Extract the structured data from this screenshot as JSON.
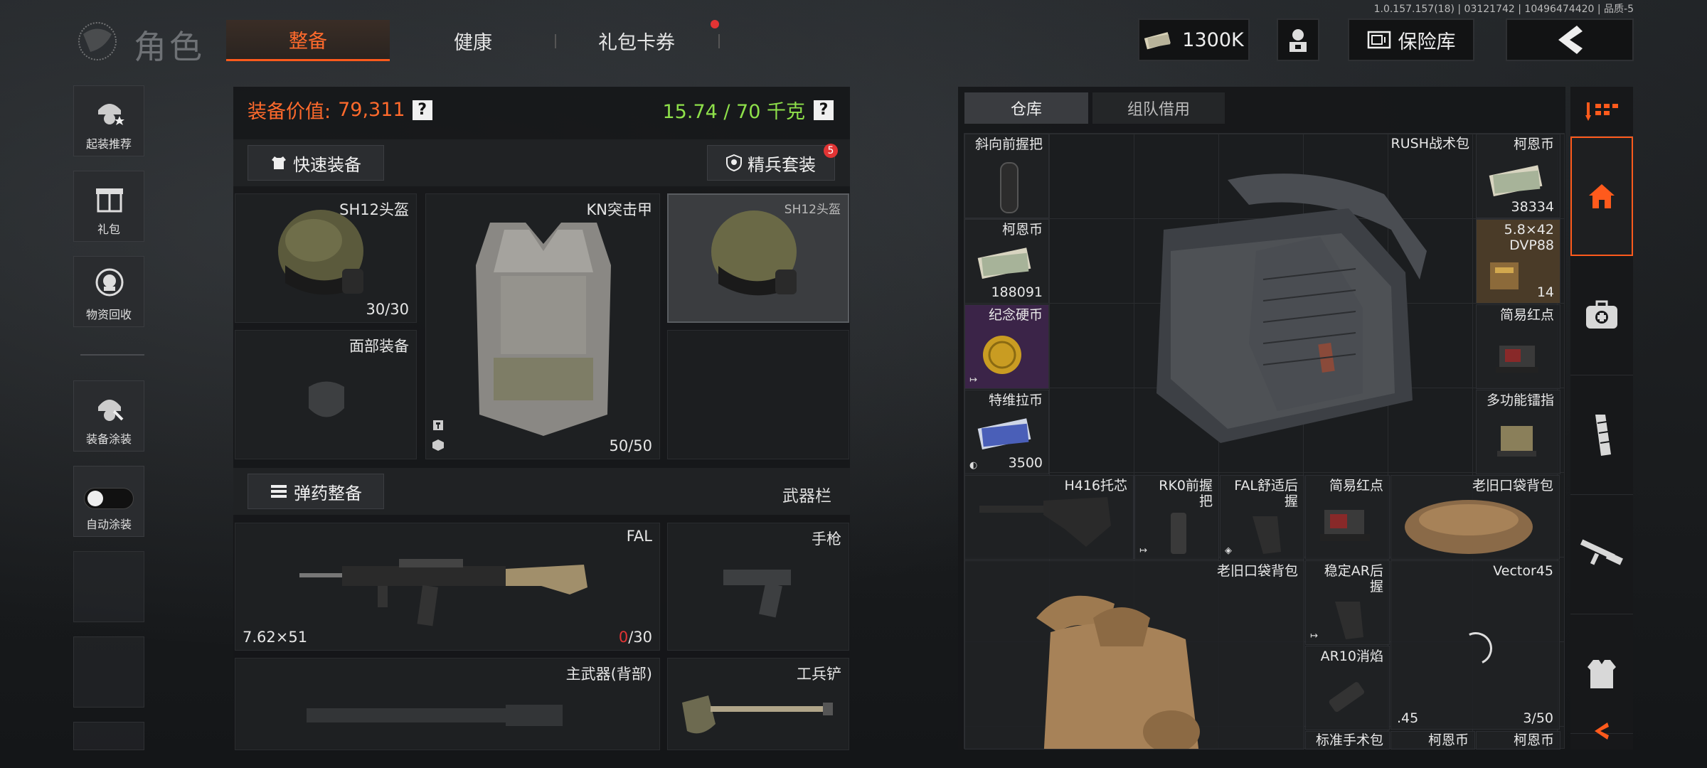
{
  "version": "1.0.157.157(18) | 03121742 | 10496474420 | 品质-5",
  "header": {
    "title": "角色",
    "tabs": [
      {
        "label": "整备",
        "active": true
      },
      {
        "label": "健康",
        "active": false
      },
      {
        "label": "礼包卡券",
        "active": false,
        "badge_dot": true
      }
    ],
    "currency": "1300K",
    "vault_label": "保险库",
    "back_icon": "chevron-left-icon"
  },
  "left_menu": [
    {
      "label": "起装推荐",
      "icon": "soldier-star-icon"
    },
    {
      "label": "礼包",
      "icon": "gift-icon"
    },
    {
      "label": "物资回收",
      "icon": "recycle-icon"
    },
    {
      "label": "装备涂装",
      "icon": "paint-helmet-icon"
    },
    {
      "label": "自动涂装",
      "icon": "toggle-icon"
    }
  ],
  "equip": {
    "value_label": "装备价值:",
    "value": "79,311",
    "weight": "15.74 / 70 千克",
    "quick_equip": "快速装备",
    "elite_set": "精兵套装",
    "elite_badge": "5",
    "ammo_button": "弹药整备",
    "weapon_bar": "武器栏",
    "slots": {
      "helmet": {
        "name": "SH12头盔",
        "count": "30/30"
      },
      "armor": {
        "name": "KN突击甲",
        "count": "50/50"
      },
      "helmet_preview": {
        "name": "SH12头盔"
      },
      "face": {
        "name": "面部装备"
      },
      "primary": {
        "name": "FAL",
        "ammo": "7.62×51",
        "mag_current": "0",
        "mag_total": "/30"
      },
      "pistol": {
        "name": "手枪"
      },
      "primary_back": {
        "name": "主武器(背部)"
      },
      "melee": {
        "name": "工兵铲"
      }
    }
  },
  "warehouse": {
    "tabs": [
      "仓库",
      "组队借用"
    ],
    "backpack": "RUSH战术包",
    "items": [
      {
        "name": "斜向前握把",
        "count": ""
      },
      {
        "name": "柯恩币",
        "count": "38334"
      },
      {
        "name": "柯恩币",
        "count": "188091"
      },
      {
        "name": "5.8×42\nDVP88",
        "count": "14"
      },
      {
        "name": "纪念硬币",
        "count": ""
      },
      {
        "name": "简易红点",
        "count": ""
      },
      {
        "name": "特维拉币",
        "count": "3500"
      },
      {
        "name": "多功能镭指",
        "count": ""
      },
      {
        "name": "H416托芯",
        "count": ""
      },
      {
        "name": "RK0前握\n把",
        "count": ""
      },
      {
        "name": "FAL舒适后\n握",
        "count": ""
      },
      {
        "name": "简易红点",
        "count": ""
      },
      {
        "name": "老旧口袋背包",
        "count": ""
      },
      {
        "name": "老旧口袋背包",
        "count": ""
      },
      {
        "name": "稳定AR后\n握",
        "count": ""
      },
      {
        "name": "Vector45",
        "count": "3/50",
        "ammo": ".45"
      },
      {
        "name": "AR10消焰",
        "count": ""
      },
      {
        "name": "标准手术包",
        "count": ""
      },
      {
        "name": "柯恩币",
        "count": ""
      },
      {
        "name": "柯恩币",
        "count": ""
      }
    ]
  },
  "right_sidebar": [
    {
      "icon": "sort-icon"
    },
    {
      "icon": "home-icon",
      "active": true
    },
    {
      "icon": "medkit-icon"
    },
    {
      "icon": "magazine-icon"
    },
    {
      "icon": "rifle-icon"
    },
    {
      "icon": "armor-icon"
    },
    {
      "icon": "collapse-left-icon"
    }
  ],
  "colors": {
    "accent": "#ff5a1c",
    "value_orange": "#ff6a2c",
    "weight_green": "#8ee04a",
    "alert_red": "#e23434"
  }
}
